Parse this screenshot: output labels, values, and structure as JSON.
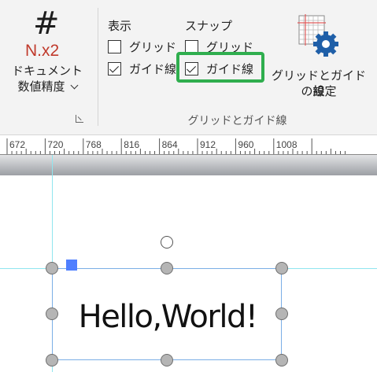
{
  "ribbon": {
    "doc_grid": {
      "icon": "hash-icon",
      "icon_glyph": "#",
      "sub_glyph": "N.x2",
      "label_line1": "ドキュメント",
      "label_line2": "数値精度"
    },
    "show": {
      "title": "表示",
      "grid_label": "グリッド",
      "grid_checked": false,
      "guides_label": "ガイド線",
      "guides_checked": true
    },
    "snap": {
      "title": "スナップ",
      "grid_label": "グリッド",
      "grid_checked": false,
      "guides_label": "ガイド線",
      "guides_checked": true
    },
    "settings_button": {
      "icon": "grid-gear-icon",
      "label_line1": "グリッドとガイド線",
      "label_line2": "の設定"
    },
    "group_label": "グリッドとガイド線",
    "highlight_color": "#2fae4e"
  },
  "ruler": {
    "labels": [
      "672",
      "720",
      "768",
      "816",
      "864",
      "912",
      "960",
      "1008"
    ]
  },
  "canvas": {
    "textbox_text": "Hello,World!",
    "guide_color": "#8fe6ef",
    "selection_color": "#7aaee6",
    "anchor_color": "#4f7fff"
  }
}
